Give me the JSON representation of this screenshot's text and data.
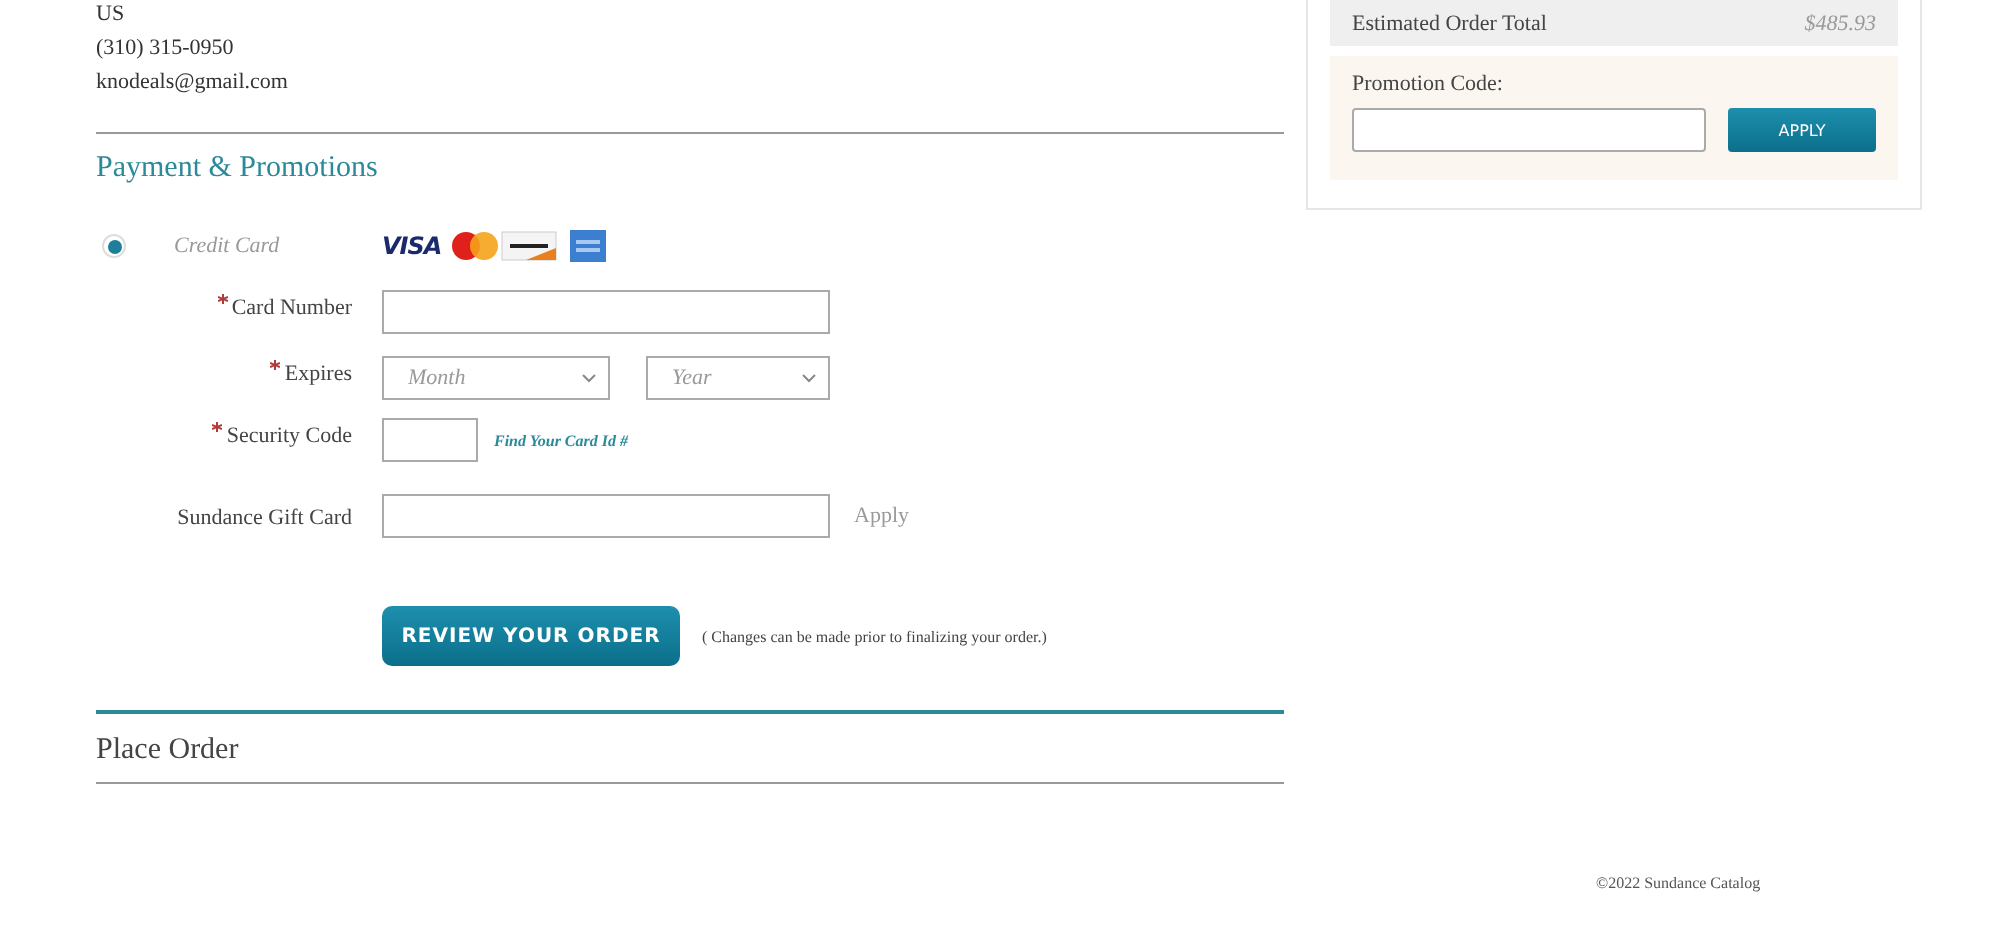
{
  "contact": {
    "country": "US",
    "phone": "(310) 315-0950",
    "email": "knodeals@gmail.com"
  },
  "payment": {
    "heading": "Payment & Promotions",
    "methods": [
      {
        "label": "Credit Card",
        "selected": true,
        "logo_text": "VISA"
      }
    ],
    "fields": [
      {
        "kind": "text",
        "label": "Card Number",
        "required": true
      },
      {
        "kind": "selects",
        "label": "Expires",
        "required": true,
        "placeholders": [
          "Month",
          "Year"
        ]
      },
      {
        "kind": "code",
        "label": "Security Code",
        "required": true,
        "link": "Find Your Card Id #"
      },
      {
        "kind": "gift",
        "label": "Sundance Gift Card",
        "required": false,
        "action": "Apply"
      }
    ],
    "submit": {
      "label": "REVIEW YOUR ORDER",
      "note": "( Changes can be made prior to finalizing your order.)"
    }
  },
  "place_order": {
    "heading": "Place Order"
  },
  "summary": {
    "total_label": "Estimated Order Total",
    "total": "$485.93",
    "promo_label": "Promotion Code:",
    "promo_button": "APPLY"
  },
  "footer": "©2022 Sundance Catalog"
}
